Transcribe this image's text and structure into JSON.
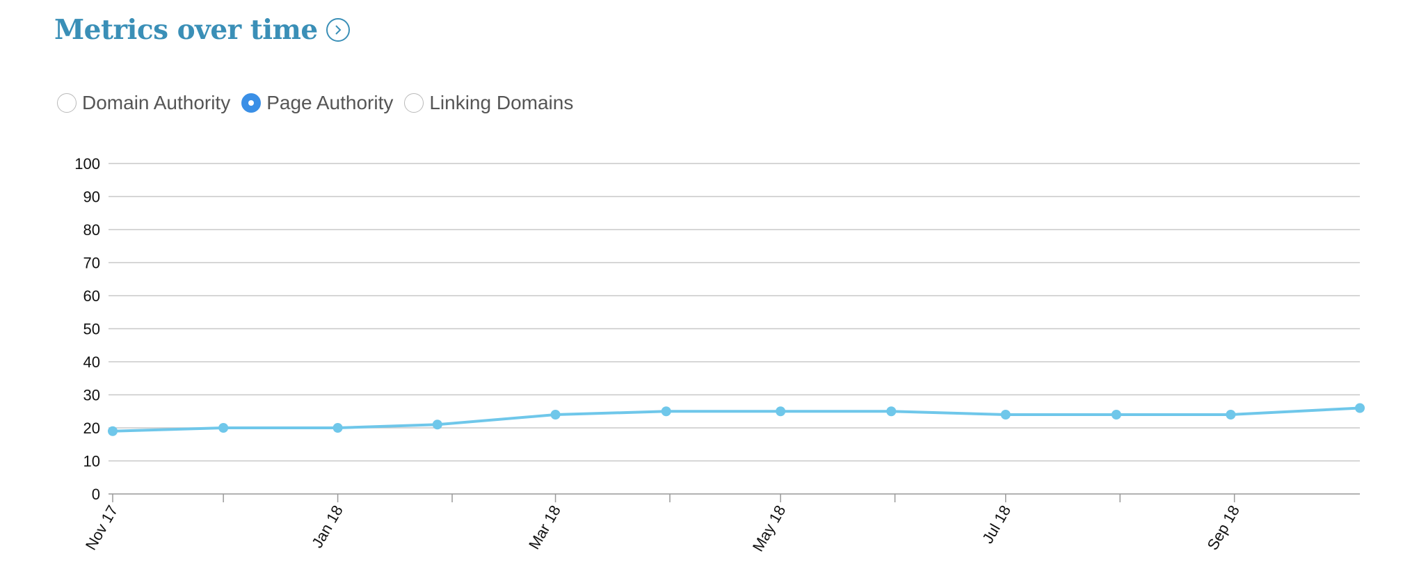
{
  "header": {
    "title": "Metrics over time",
    "link_icon": "chevron-right-circle-icon"
  },
  "metric_options": [
    {
      "label": "Domain Authority",
      "selected": false
    },
    {
      "label": "Page Authority",
      "selected": true
    },
    {
      "label": "Linking Domains",
      "selected": false
    }
  ],
  "colors": {
    "accent": "#3a8fb7",
    "line": "#6fc7ea",
    "radio_selected": "#3a8fe6"
  },
  "chart_data": {
    "type": "line",
    "title": "",
    "xlabel": "",
    "ylabel": "",
    "ylim": [
      0,
      100
    ],
    "yticks": [
      0,
      10,
      20,
      30,
      40,
      50,
      60,
      70,
      80,
      90,
      100
    ],
    "xticks": [
      {
        "date": "2017-11-01",
        "label": "Nov 17"
      },
      {
        "date": "2017-12-01",
        "label": ""
      },
      {
        "date": "2018-01-01",
        "label": "Jan 18"
      },
      {
        "date": "2018-02-01",
        "label": ""
      },
      {
        "date": "2018-03-01",
        "label": "Mar 18"
      },
      {
        "date": "2018-04-01",
        "label": ""
      },
      {
        "date": "2018-05-01",
        "label": "May 18"
      },
      {
        "date": "2018-06-01",
        "label": ""
      },
      {
        "date": "2018-07-01",
        "label": "Jul 18"
      },
      {
        "date": "2018-08-01",
        "label": ""
      },
      {
        "date": "2018-09-01",
        "label": "Sep 18"
      }
    ],
    "xlim": [
      "2017-11-01",
      "2018-10-05"
    ],
    "grid": true,
    "series": [
      {
        "x": [
          "2017-11-01",
          "2017-12-01",
          "2018-01-01",
          "2018-01-28",
          "2018-03-01",
          "2018-03-31",
          "2018-05-01",
          "2018-05-31",
          "2018-07-01",
          "2018-07-31",
          "2018-08-31",
          "2018-10-05"
        ],
        "values": [
          19,
          20,
          20,
          21,
          24,
          25,
          25,
          25,
          24,
          24,
          24,
          26
        ]
      }
    ]
  }
}
